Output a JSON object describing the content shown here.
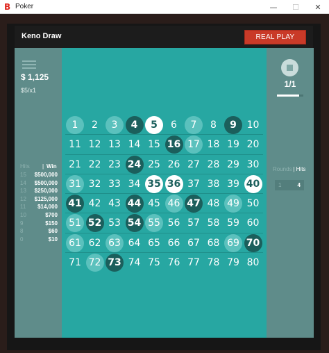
{
  "window": {
    "title": "Poker",
    "logo": "B",
    "minimize": "—",
    "maximize": "☐",
    "close": "✕"
  },
  "header": {
    "title": "Keno Draw",
    "real_play_label": "REAL PLAY"
  },
  "left": {
    "balance": "$ 1,125",
    "bet": "$5/x1",
    "paytable_hits_label": "Hits",
    "paytable_win_label": "Win",
    "paytable": [
      {
        "hits": "15",
        "win": "$500,000"
      },
      {
        "hits": "14",
        "win": "$500,000"
      },
      {
        "hits": "13",
        "win": "$250,000"
      },
      {
        "hits": "12",
        "win": "$125,000"
      },
      {
        "hits": "11",
        "win": "$14,000"
      },
      {
        "hits": "10",
        "win": "$700"
      },
      {
        "hits": "9",
        "win": "$150"
      },
      {
        "hits": "8",
        "win": "$60"
      },
      {
        "hits": "0",
        "win": "$10"
      }
    ]
  },
  "right": {
    "game_counter": "1/1",
    "progress": 0.85,
    "rounds_label": "Rounds",
    "hits_label": "Hits",
    "rounds_value": "1",
    "hits_value": "4"
  },
  "board": {
    "numbers": [
      [
        {
          "n": "1",
          "s": "light"
        },
        {
          "n": "2",
          "s": "none"
        },
        {
          "n": "3",
          "s": "light"
        },
        {
          "n": "4",
          "s": "dark"
        },
        {
          "n": "5",
          "s": "white"
        },
        {
          "n": "6",
          "s": "none"
        },
        {
          "n": "7",
          "s": "light"
        },
        {
          "n": "8",
          "s": "none"
        },
        {
          "n": "9",
          "s": "dark"
        },
        {
          "n": "10",
          "s": "none"
        }
      ],
      [
        {
          "n": "11",
          "s": "none"
        },
        {
          "n": "12",
          "s": "none"
        },
        {
          "n": "13",
          "s": "none"
        },
        {
          "n": "14",
          "s": "none"
        },
        {
          "n": "15",
          "s": "none"
        },
        {
          "n": "16",
          "s": "dark"
        },
        {
          "n": "17",
          "s": "light"
        },
        {
          "n": "18",
          "s": "none"
        },
        {
          "n": "19",
          "s": "none"
        },
        {
          "n": "20",
          "s": "none"
        }
      ],
      [
        {
          "n": "21",
          "s": "none"
        },
        {
          "n": "22",
          "s": "none"
        },
        {
          "n": "23",
          "s": "none"
        },
        {
          "n": "24",
          "s": "dark"
        },
        {
          "n": "25",
          "s": "none"
        },
        {
          "n": "26",
          "s": "none"
        },
        {
          "n": "27",
          "s": "none"
        },
        {
          "n": "28",
          "s": "none"
        },
        {
          "n": "29",
          "s": "none"
        },
        {
          "n": "30",
          "s": "none"
        }
      ],
      [
        {
          "n": "31",
          "s": "light"
        },
        {
          "n": "32",
          "s": "none"
        },
        {
          "n": "33",
          "s": "none"
        },
        {
          "n": "34",
          "s": "none"
        },
        {
          "n": "35",
          "s": "white"
        },
        {
          "n": "36",
          "s": "white"
        },
        {
          "n": "37",
          "s": "none"
        },
        {
          "n": "38",
          "s": "none"
        },
        {
          "n": "39",
          "s": "none"
        },
        {
          "n": "40",
          "s": "white"
        }
      ],
      [
        {
          "n": "41",
          "s": "dark"
        },
        {
          "n": "42",
          "s": "none"
        },
        {
          "n": "43",
          "s": "none"
        },
        {
          "n": "44",
          "s": "dark"
        },
        {
          "n": "45",
          "s": "none"
        },
        {
          "n": "46",
          "s": "light"
        },
        {
          "n": "47",
          "s": "dark"
        },
        {
          "n": "48",
          "s": "none"
        },
        {
          "n": "49",
          "s": "light"
        },
        {
          "n": "50",
          "s": "none"
        }
      ],
      [
        {
          "n": "51",
          "s": "light"
        },
        {
          "n": "52",
          "s": "dark"
        },
        {
          "n": "53",
          "s": "none"
        },
        {
          "n": "54",
          "s": "dark"
        },
        {
          "n": "55",
          "s": "light"
        },
        {
          "n": "56",
          "s": "none"
        },
        {
          "n": "57",
          "s": "none"
        },
        {
          "n": "58",
          "s": "none"
        },
        {
          "n": "59",
          "s": "none"
        },
        {
          "n": "60",
          "s": "none"
        }
      ],
      [
        {
          "n": "61",
          "s": "light"
        },
        {
          "n": "62",
          "s": "none"
        },
        {
          "n": "63",
          "s": "light"
        },
        {
          "n": "64",
          "s": "none"
        },
        {
          "n": "65",
          "s": "none"
        },
        {
          "n": "66",
          "s": "none"
        },
        {
          "n": "67",
          "s": "none"
        },
        {
          "n": "68",
          "s": "none"
        },
        {
          "n": "69",
          "s": "light"
        },
        {
          "n": "70",
          "s": "dark"
        }
      ],
      [
        {
          "n": "71",
          "s": "none"
        },
        {
          "n": "72",
          "s": "light"
        },
        {
          "n": "73",
          "s": "dark"
        },
        {
          "n": "74",
          "s": "none"
        },
        {
          "n": "75",
          "s": "none"
        },
        {
          "n": "76",
          "s": "none"
        },
        {
          "n": "77",
          "s": "none"
        },
        {
          "n": "78",
          "s": "none"
        },
        {
          "n": "79",
          "s": "none"
        },
        {
          "n": "80",
          "s": "none"
        }
      ]
    ]
  },
  "colors": {
    "board": "#27a7a2",
    "side_panel": "#5f8c8a",
    "real_play": "#c93a28",
    "ball_light": "#5bc1bd",
    "ball_dark": "#1b5f5c",
    "ball_white": "#ffffff"
  }
}
